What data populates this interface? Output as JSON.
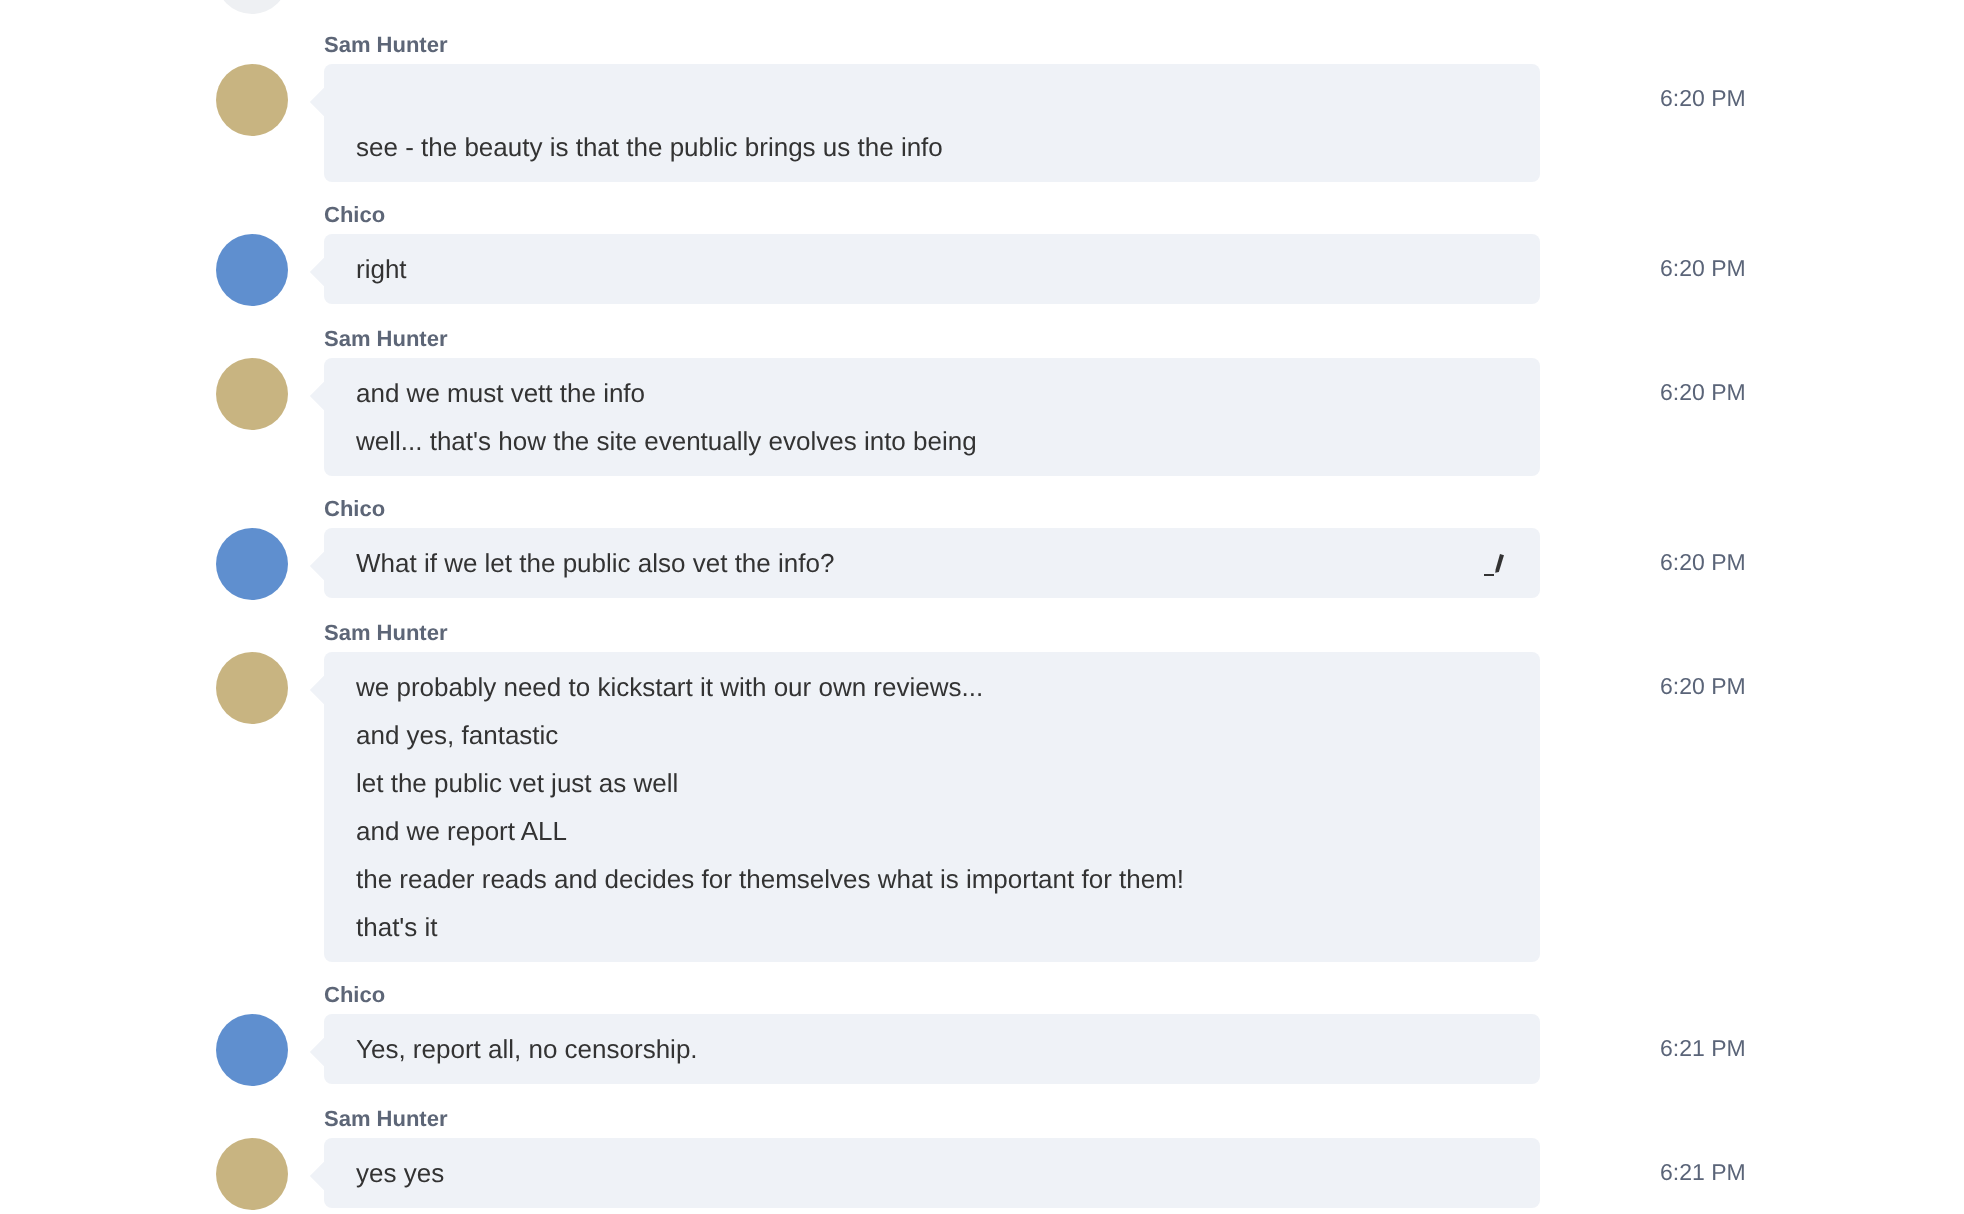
{
  "messages": [
    {
      "sender": "Sam Hunter",
      "avatar": {
        "color": "#c8b481"
      },
      "leading_blank_line": true,
      "lines": [
        "see - the beauty is that the public brings us the info"
      ],
      "time": "6:20 PM",
      "edited": false
    },
    {
      "sender": "Chico",
      "avatar": {
        "color": "#5f8fcf"
      },
      "leading_blank_line": false,
      "lines": [
        "right"
      ],
      "time": "6:20 PM",
      "edited": false
    },
    {
      "sender": "Sam Hunter",
      "avatar": {
        "color": "#c8b481"
      },
      "leading_blank_line": false,
      "lines": [
        "and we must vett the info",
        "well... that's how the site eventually evolves into being"
      ],
      "time": "6:20 PM",
      "edited": false
    },
    {
      "sender": "Chico",
      "avatar": {
        "color": "#5f8fcf"
      },
      "leading_blank_line": false,
      "lines": [
        "What if we let the public also vet the info?"
      ],
      "time": "6:20 PM",
      "edited": true
    },
    {
      "sender": "Sam Hunter",
      "avatar": {
        "color": "#c8b481"
      },
      "leading_blank_line": false,
      "lines": [
        "we probably need to kickstart it with our own reviews...",
        "and yes, fantastic",
        "let the public vet just as well",
        "and we report ALL",
        "the reader reads and decides for themselves what is important for them!",
        "that's it"
      ],
      "time": "6:20 PM",
      "edited": false
    },
    {
      "sender": "Chico",
      "avatar": {
        "color": "#5f8fcf"
      },
      "leading_blank_line": false,
      "lines": [
        "Yes, report all, no censorship."
      ],
      "time": "6:21 PM",
      "edited": false
    },
    {
      "sender": "Sam Hunter",
      "avatar": {
        "color": "#c8b481"
      },
      "leading_blank_line": false,
      "lines": [
        "yes yes"
      ],
      "time": "6:21 PM",
      "edited": false
    }
  ]
}
